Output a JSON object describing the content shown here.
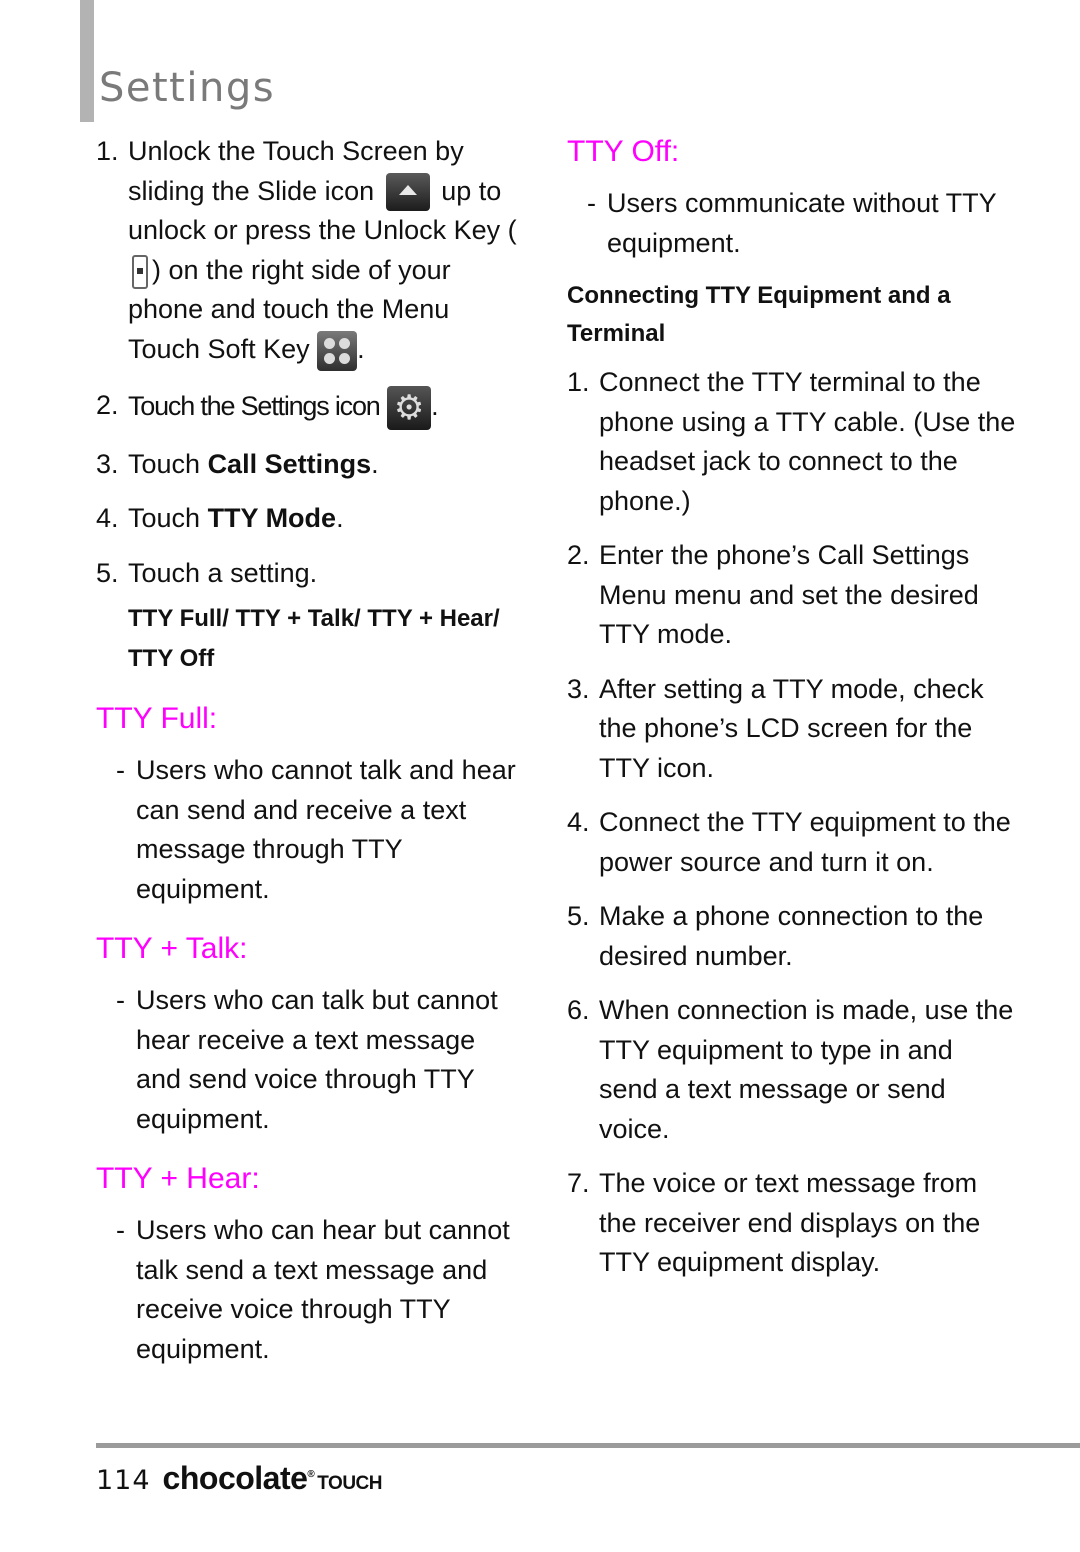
{
  "header": {
    "title": "Settings"
  },
  "left_steps": [
    {
      "num": "1.",
      "parts": [
        "Unlock the Touch Screen by sliding the Slide icon",
        "up to unlock or press the Unlock Key (",
        ") on the right side of your phone and touch the Menu Touch Soft Key",
        "."
      ],
      "icons": [
        "slide-icon",
        "unlock-key-icon",
        "menu-icon"
      ]
    },
    {
      "num": "2.",
      "parts": [
        "Touch the Settings icon",
        "."
      ],
      "icons": [
        "settings-icon"
      ]
    },
    {
      "num": "3.",
      "prefix": "Touch ",
      "bold": "Call Settings",
      "suffix": "."
    },
    {
      "num": "4.",
      "prefix": "Touch ",
      "bold": "TTY Mode",
      "suffix": "."
    },
    {
      "num": "5.",
      "text": "Touch a setting."
    }
  ],
  "setting_options": "TTY Full/ TTY + Talk/ TTY + Hear/ TTY Off",
  "modes": [
    {
      "heading": "TTY Full:",
      "description": "Users who cannot  talk and hear can send and receive a text message through TTY equipment."
    },
    {
      "heading": "TTY + Talk:",
      "description": "Users who can talk but cannot hear receive a text message and send voice through TTY equipment."
    },
    {
      "heading": "TTY + Hear:",
      "description": "Users who can hear but cannot talk send a text message and receive voice through TTY equipment."
    },
    {
      "heading": "TTY Off:",
      "description": "Users communicate without TTY equipment."
    }
  ],
  "connecting": {
    "heading": "Connecting TTY Equipment and a Terminal",
    "steps": [
      {
        "num": "1.",
        "text": "Connect the TTY terminal to the phone using a TTY cable. (Use the headset jack to connect to the phone.)"
      },
      {
        "num": "2.",
        "text": "Enter the phone’s Call Settings Menu menu and set the desired TTY mode."
      },
      {
        "num": "3.",
        "text": "After setting a TTY mode, check the phone’s LCD screen for the TTY icon."
      },
      {
        "num": "4.",
        "text": "Connect the TTY equipment to the power source and turn it on."
      },
      {
        "num": "5.",
        "text": "Make a phone connection to the desired number."
      },
      {
        "num": "6.",
        "text": "When connection is made, use the TTY equipment to type in and send a text message or send voice."
      },
      {
        "num": "7.",
        "text": "The voice or text message from the receiver end displays on the TTY equipment display."
      }
    ]
  },
  "footer": {
    "page_number": "114",
    "brand": "chocolate",
    "brand_mark": "®",
    "brand_sub": "TOUCH"
  },
  "colors": {
    "accent": "#ff00ff",
    "header_bar": "#b3b3b3",
    "title": "#7a7a7a",
    "rule": "#9b9b9b"
  }
}
